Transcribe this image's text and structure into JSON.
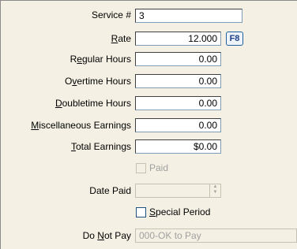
{
  "form": {
    "service": {
      "label": "Service #",
      "value": "3"
    },
    "rate": {
      "label_pre": "",
      "label_u": "R",
      "label_post": "ate",
      "value": "12.000",
      "hotkey": "F8"
    },
    "regular_hours": {
      "label_pre": "R",
      "label_u": "e",
      "label_post": "gular Hours",
      "value": "0.00"
    },
    "overtime_hours": {
      "label_pre": "O",
      "label_u": "v",
      "label_post": "ertime Hours",
      "value": "0.00"
    },
    "doubletime_hours": {
      "label_pre": "",
      "label_u": "D",
      "label_post": "oubletime Hours",
      "value": "0.00"
    },
    "misc_earnings": {
      "label_pre": "",
      "label_u": "M",
      "label_post": "iscellaneous Earnings",
      "value": "0.00"
    },
    "total_earnings": {
      "label_pre": "",
      "label_u": "T",
      "label_post": "otal Earnings",
      "value": "$0.00"
    },
    "paid": {
      "label": "Paid",
      "checked": false
    },
    "date_paid": {
      "label": "Date Paid",
      "value": ""
    },
    "special_period": {
      "label_pre": "",
      "label_u": "S",
      "label_post": "pecial Period",
      "checked": false
    },
    "do_not_pay": {
      "label_pre": "Do ",
      "label_u": "N",
      "label_post": "ot Pay",
      "value": "000-OK to Pay"
    }
  }
}
